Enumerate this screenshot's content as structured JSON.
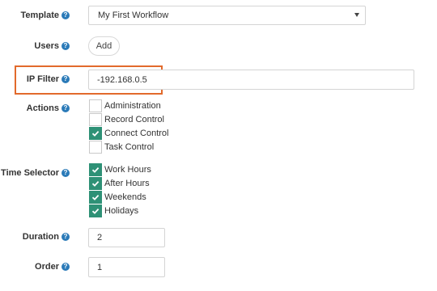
{
  "template": {
    "label": "Template",
    "value": "My First Workflow"
  },
  "users": {
    "label": "Users",
    "add_label": "Add"
  },
  "ip_filter": {
    "label": "IP Filter",
    "value": "-192.168.0.5"
  },
  "actions": {
    "label": "Actions",
    "items": [
      {
        "label": "Administration",
        "checked": false
      },
      {
        "label": "Record Control",
        "checked": false
      },
      {
        "label": "Connect Control",
        "checked": true
      },
      {
        "label": "Task Control",
        "checked": false
      }
    ]
  },
  "time_selector": {
    "label": "Time Selector",
    "items": [
      {
        "label": "Work Hours",
        "checked": true
      },
      {
        "label": "After Hours",
        "checked": true
      },
      {
        "label": "Weekends",
        "checked": true
      },
      {
        "label": "Holidays",
        "checked": true
      }
    ]
  },
  "duration": {
    "label": "Duration",
    "value": "2"
  },
  "order": {
    "label": "Order",
    "value": "1"
  },
  "help_glyph": "?",
  "colors": {
    "accent": "#2e9176",
    "highlight": "#e26a2c",
    "help": "#2a7ab8"
  }
}
